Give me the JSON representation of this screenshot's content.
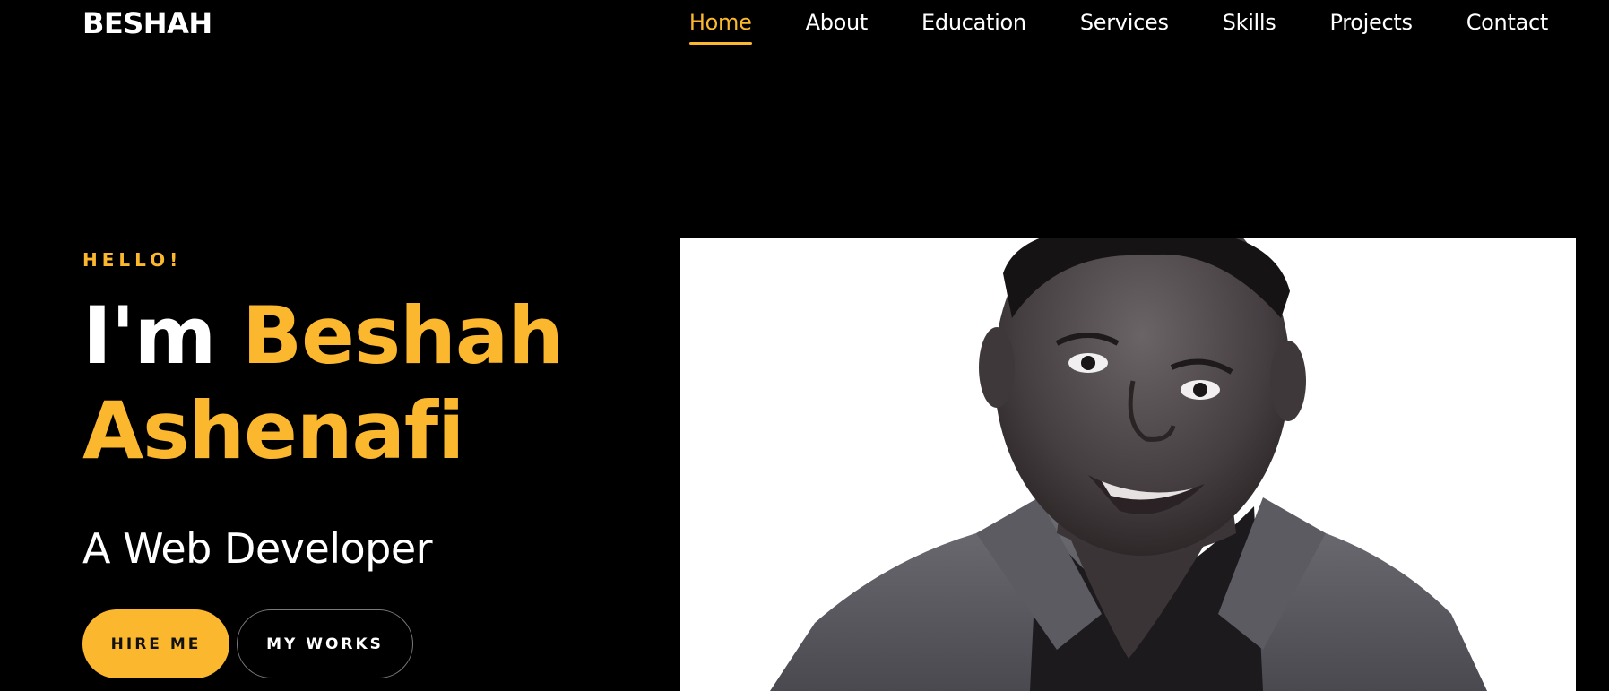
{
  "navbar": {
    "logo": "BESHAH",
    "links": [
      {
        "label": "Home",
        "active": true
      },
      {
        "label": "About",
        "active": false
      },
      {
        "label": "Education",
        "active": false
      },
      {
        "label": "Services",
        "active": false
      },
      {
        "label": "Skills",
        "active": false
      },
      {
        "label": "Projects",
        "active": false
      },
      {
        "label": "Contact",
        "active": false
      }
    ]
  },
  "hero": {
    "greeting": "HELLO!",
    "intro": "I'm",
    "first_name": "Beshah",
    "last_name": "Ashenafi",
    "role": "A Web Developer",
    "primary_button": "HIRE ME",
    "secondary_button": "MY WORKS"
  },
  "colors": {
    "accent": "#fbb82e",
    "background": "#000000",
    "text": "#ffffff"
  }
}
